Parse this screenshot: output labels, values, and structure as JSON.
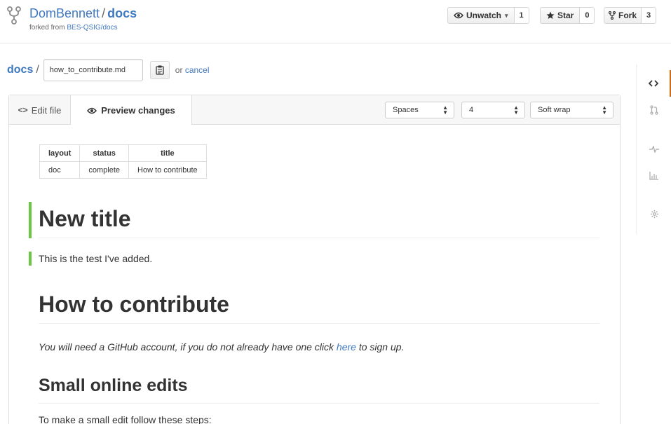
{
  "repo": {
    "owner": "DomBennett",
    "separator": "/",
    "name": "docs",
    "forked_label": "forked from",
    "forked_link": "BES-QSIG/docs"
  },
  "actions": {
    "watch_label": "Unwatch",
    "watch_caret": "▾",
    "watch_count": "1",
    "star_label": "Star",
    "star_count": "0",
    "fork_label": "Fork",
    "fork_count": "3"
  },
  "breadcrumb": {
    "root": "docs",
    "separator": "/",
    "filename": "how_to_contribute.md",
    "or_text": "or",
    "cancel": "cancel"
  },
  "tabs": {
    "edit": "Edit file",
    "preview": "Preview changes",
    "edit_glyph": "<>"
  },
  "editor_options": {
    "indent_mode": "Spaces",
    "indent_size": "4",
    "wrap_mode": "Soft wrap"
  },
  "front_matter": {
    "headers": [
      "layout",
      "status",
      "title"
    ],
    "row": [
      "doc",
      "complete",
      "How to contribute"
    ]
  },
  "content": {
    "added_heading": "New title",
    "added_paragraph": "This is the test I've added.",
    "heading": "How to contribute",
    "intro_before": "You will need a GitHub account, if you do not already have one click ",
    "intro_link": "here",
    "intro_after": " to sign up.",
    "subheading": "Small online edits",
    "partial_line": "To make a small edit follow these steps:"
  },
  "colors": {
    "link": "#4078c0",
    "added_marker": "#6cc644",
    "nav_selected": "#d26911"
  },
  "right_nav_icons": [
    "code-icon",
    "pull-request-icon",
    "pulse-icon",
    "graphs-icon",
    "settings-icon"
  ]
}
